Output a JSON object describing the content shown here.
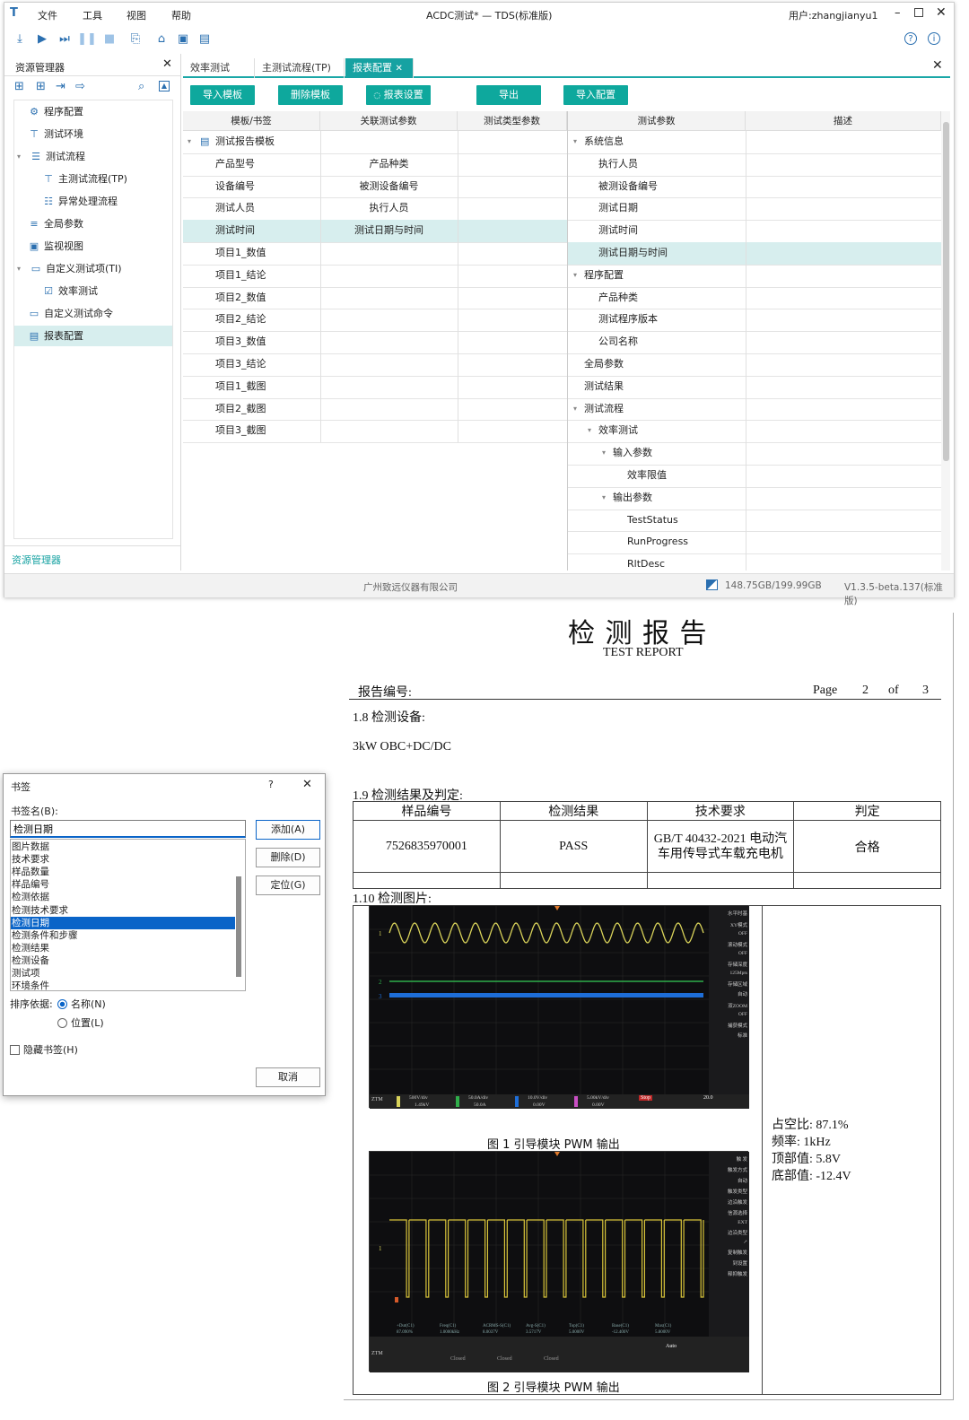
{
  "window": {
    "title": "ACDC测试* — TDS(标准版)",
    "user": "用户:zhangjianyu1",
    "menu": [
      "文件",
      "工具",
      "视图",
      "帮助"
    ]
  },
  "sidebar": {
    "title": "资源管理器",
    "bottom_tab": "资源管理器",
    "items": [
      {
        "label": "程序配置",
        "icon": "gear-icon"
      },
      {
        "label": "测试环境",
        "icon": "plug-icon"
      },
      {
        "label": "测试流程",
        "icon": "list-icon"
      },
      {
        "label": "主测试流程(TP)",
        "icon": "flow-icon"
      },
      {
        "label": "异常处理流程",
        "icon": "exception-icon"
      },
      {
        "label": "全局参数",
        "icon": "params-icon"
      },
      {
        "label": "监视视图",
        "icon": "monitor-icon"
      },
      {
        "label": "自定义测试项(TI)",
        "icon": "folder-icon"
      },
      {
        "label": "效率测试",
        "icon": "test-item-icon"
      },
      {
        "label": "自定义测试命令",
        "icon": "folder-icon"
      },
      {
        "label": "报表配置",
        "icon": "report-icon"
      }
    ]
  },
  "tabs": [
    "效率测试",
    "主测试流程(TP)",
    "报表配置"
  ],
  "buttons": [
    "导入模板",
    "删除模板",
    "报表设置",
    "导出",
    "导入配置"
  ],
  "left_grid": {
    "headers": [
      "模板/书签",
      "关联测试参数",
      "测试类型参数"
    ],
    "rows": [
      {
        "bookmark": "测试报告模板",
        "param": "",
        "type": ""
      },
      {
        "bookmark": "产品型号",
        "param": "产品种类",
        "type": ""
      },
      {
        "bookmark": "设备编号",
        "param": "被测设备编号",
        "type": ""
      },
      {
        "bookmark": "测试人员",
        "param": "执行人员",
        "type": ""
      },
      {
        "bookmark": "测试时间",
        "param": "测试日期与时间",
        "type": ""
      },
      {
        "bookmark": "项目1_数值",
        "param": "",
        "type": ""
      },
      {
        "bookmark": "项目1_结论",
        "param": "",
        "type": ""
      },
      {
        "bookmark": "项目2_数值",
        "param": "",
        "type": ""
      },
      {
        "bookmark": "项目2_结论",
        "param": "",
        "type": ""
      },
      {
        "bookmark": "项目3_数值",
        "param": "",
        "type": ""
      },
      {
        "bookmark": "项目3_结论",
        "param": "",
        "type": ""
      },
      {
        "bookmark": "项目1_截图",
        "param": "",
        "type": ""
      },
      {
        "bookmark": "项目2_截图",
        "param": "",
        "type": ""
      },
      {
        "bookmark": "项目3_截图",
        "param": "",
        "type": ""
      }
    ]
  },
  "right_grid": {
    "headers": [
      "测试参数",
      "描述"
    ],
    "rows": [
      {
        "label": "系统信息",
        "level": 0,
        "expand": true
      },
      {
        "label": "执行人员",
        "level": 1
      },
      {
        "label": "被测设备编号",
        "level": 1
      },
      {
        "label": "测试日期",
        "level": 1
      },
      {
        "label": "测试时间",
        "level": 1
      },
      {
        "label": "测试日期与时间",
        "level": 1
      },
      {
        "label": "程序配置",
        "level": 0,
        "expand": true
      },
      {
        "label": "产品种类",
        "level": 1
      },
      {
        "label": "测试程序版本",
        "level": 1
      },
      {
        "label": "公司名称",
        "level": 1
      },
      {
        "label": "全局参数",
        "level": 0
      },
      {
        "label": "测试结果",
        "level": 0
      },
      {
        "label": "测试流程",
        "level": 0,
        "expand": true
      },
      {
        "label": "效率测试",
        "level": 1,
        "expand": true
      },
      {
        "label": "输入参数",
        "level": 2,
        "expand": true
      },
      {
        "label": "效率限值",
        "level": 3
      },
      {
        "label": "输出参数",
        "level": 2,
        "expand": true
      },
      {
        "label": "TestStatus",
        "level": 3
      },
      {
        "label": "RunProgress",
        "level": 3
      },
      {
        "label": "RltDesc",
        "level": 3
      }
    ]
  },
  "status": {
    "company": "广州致远仪器有限公司",
    "disk": "148.75GB/199.99GB",
    "version": "V1.3.5-beta.137(标准版)"
  },
  "report": {
    "title": "检 测 报 告",
    "subtitle": "TEST REPORT",
    "number_label": "报告编号:",
    "page_word": "Page",
    "page_num": "2",
    "of_word": "of",
    "page_total": "3",
    "s18": "1.8  检测设备:",
    "device": "3kW OBC+DC/DC",
    "s19": "1.9  检测结果及判定:",
    "table_headers": [
      "样品编号",
      "检测结果",
      "技术要求",
      "判定"
    ],
    "table_row": [
      "7526835970001",
      "PASS",
      "GB/T 40432-2021 电动汽车用传导式车载充电机",
      "合格"
    ],
    "s110": "1.10  检测图片:",
    "caption1": "图 1 引导模块 PWM 输出",
    "caption2": "图 2 引导模块 PWM 输出",
    "measurements": [
      "占空比: 87.1%",
      "频率: 1kHz",
      "顶部值: 5.8V",
      "底部值: -12.4V"
    ]
  },
  "scope1": {
    "menu": [
      "水平时基",
      "XY模式",
      "OFF",
      "滚动模式",
      "OFF",
      "存储深度",
      "125Mpts",
      "存储区域",
      "自动",
      "双ZOOM",
      "OFF",
      "捕获模式",
      "标准"
    ],
    "ch_labels": [
      "500V/div",
      "50.0A/div",
      "10.0V/div",
      "5.00kV/div"
    ],
    "ch_values": [
      "1.49kV",
      "50.0A",
      "0.00V",
      "0.00V"
    ],
    "brand": "ZTM",
    "run": "Stop",
    "time": "20.0"
  },
  "scope2": {
    "menu": [
      "触 发",
      "触发方式",
      "自动",
      "触发类型",
      "边沿触发",
      "信源选择",
      "EXT",
      "边沿类型",
      "↗",
      "复制触发",
      "到设置",
      "释抑触发"
    ],
    "meas_labels": [
      "+Dut(C1)",
      "Freq(C1)",
      "ACRMS-S(C1)",
      "Avg-S(C1)",
      "Top(C1)",
      "Base(C1)",
      "Max(C1)"
    ],
    "meas_values": [
      "87.090%",
      "1.0000kHz",
      "8.0037V",
      "3.5717V",
      "5.0000V",
      "-12.400V",
      "5.8000V"
    ],
    "brand": "ZTM",
    "run": "Auto",
    "closed": [
      "Closed",
      "Closed",
      "Closed"
    ]
  },
  "dialog": {
    "title": "书签",
    "help": "?",
    "name_label": "书签名(B):",
    "name_value": "检测日期",
    "list": [
      "图片数据",
      "技术要求",
      "样品数量",
      "样品编号",
      "检测依据",
      "检测技术要求",
      "检测日期",
      "检测条件和步骤",
      "检测结果",
      "检测设备",
      "测试项",
      "环境条件"
    ],
    "selected_index": 6,
    "add": "添加(A)",
    "delete": "删除(D)",
    "locate": "定位(G)",
    "sort_label": "排序依据:",
    "sort_name": "名称(N)",
    "sort_pos": "位置(L)",
    "hidden": "隐藏书签(H)",
    "cancel": "取消"
  },
  "colors": {
    "accent": "#0ea89d",
    "tab_active": "#16a2a2",
    "selection": "#d7eeee",
    "dialog_sel": "#0a64c8"
  }
}
